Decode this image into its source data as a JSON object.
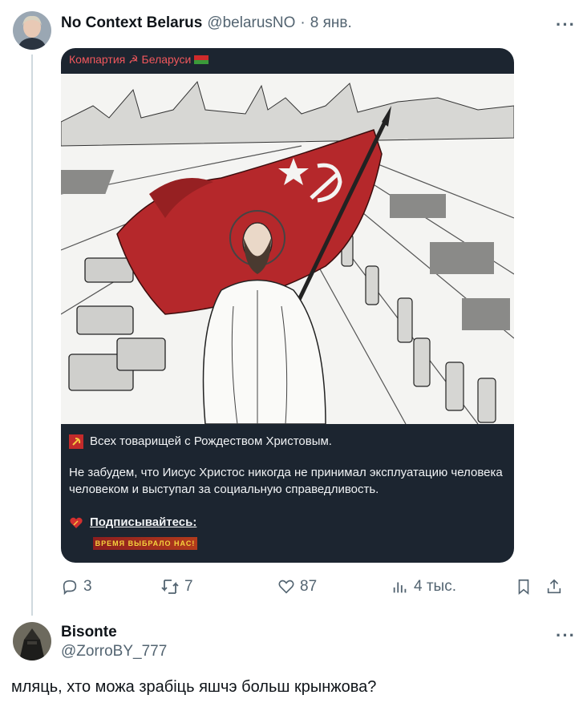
{
  "tweet": {
    "name": "No Context Belarus",
    "handle": "@belarusNO",
    "dot": "·",
    "time": "8 янв.",
    "more": "···",
    "media": {
      "source": "Компартия ☭ Беларуси",
      "line1": "Всех товарищей с Рождеством Христовым.",
      "paragraph": "Не забудем, что Иисус Христос никогда не принимал эксплуатацию человека человеком и выступал за социальную справедливость.",
      "subscribe": "Подписывайтесь:",
      "badge": "ВРЕМЯ ВЫБРАЛО НАС!"
    },
    "actions": {
      "replies": "3",
      "retweets": "7",
      "likes": "87",
      "views": "4 тыс."
    }
  },
  "reply": {
    "name": "Bisonte",
    "handle": "@ZorroBY_777",
    "more": "···",
    "text": "мляць, хто можа зрабіць яшчэ больш крынжова?"
  }
}
